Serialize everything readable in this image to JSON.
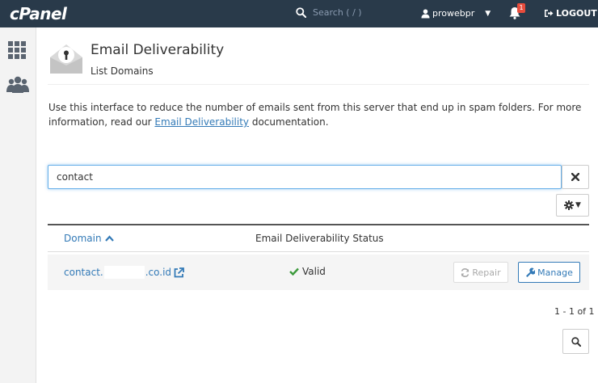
{
  "app": {
    "logo": "cPanel"
  },
  "topbar": {
    "search_placeholder": "Search ( / )",
    "username": "prowebpr",
    "notification_count": "1",
    "logout_label": "LOGOUT"
  },
  "sidebar": {
    "items": [
      {
        "icon": "grid-icon"
      },
      {
        "icon": "users-icon"
      }
    ]
  },
  "header": {
    "title": "Email Deliverability",
    "subtitle": "List Domains"
  },
  "description": {
    "text_before": "Use this interface to reduce the number of emails sent from this server that end up in spam folders. For more information, read our ",
    "link_text": "Email Deliverability",
    "text_after": " documentation."
  },
  "filter": {
    "value": "contact"
  },
  "table": {
    "headers": {
      "domain": "Domain",
      "status": "Email Deliverability Status"
    },
    "rows": [
      {
        "domain_prefix": "contact.",
        "domain_suffix": ".co.id",
        "status": "Valid",
        "repair_label": "Repair",
        "manage_label": "Manage"
      }
    ],
    "pagination": "1 - 1 of 1"
  },
  "colors": {
    "topbar": "#293a4a",
    "link": "#337ab7",
    "valid": "#3c9a3c",
    "badge": "#e74c3c"
  }
}
